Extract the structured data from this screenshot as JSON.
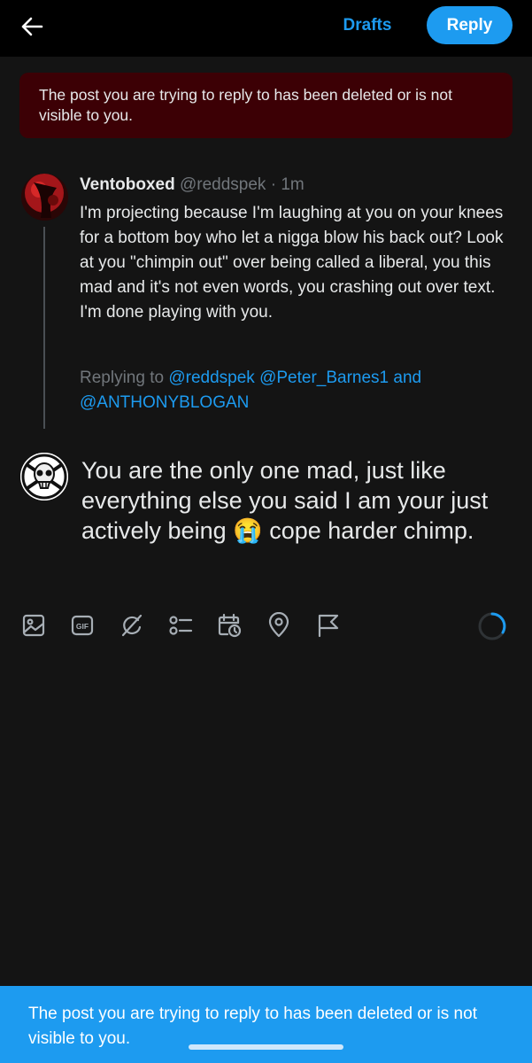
{
  "header": {
    "back_icon": "arrow-left-icon",
    "drafts_label": "Drafts",
    "reply_label": "Reply"
  },
  "error_banner": {
    "text": "The post you are trying to reply to has been deleted or is not visible to you."
  },
  "parent_tweet": {
    "display_name": "Ventoboxed",
    "handle": "@reddspek",
    "separator": " · ",
    "time": "1m",
    "body": "I'm projecting because I'm laughing at you on your knees for a bottom boy who let a nigga blow his back out? Look at you \"chimpin out\" over being called a liberal, you this mad and it's not even words, you crashing out over text. I'm done playing with you.",
    "replying_prefix": "Replying to",
    "replying_user1": "@reddspek",
    "replying_user2": "@Peter_Barnes1",
    "replying_and": "and",
    "replying_user3": "@ANTHONYBLOGAN"
  },
  "compose": {
    "text_before_emoji": "You are the only one mad, just like everything else you said I am your just actively being ",
    "emoji": "😭",
    "text_after_emoji": " cope harder chimp."
  },
  "toolbar": {
    "icons": [
      "image-icon",
      "gif-icon",
      "grok-icon",
      "poll-icon",
      "schedule-icon",
      "location-icon",
      "flag-icon"
    ],
    "gif_label": "GIF"
  },
  "bottom_toast": {
    "text": "The post you are trying to reply to has been deleted or is not visible to you."
  },
  "colors": {
    "accent": "#1d9bf0",
    "error_bg": "#3c0005",
    "background": "#141414",
    "topbar": "#000000"
  }
}
